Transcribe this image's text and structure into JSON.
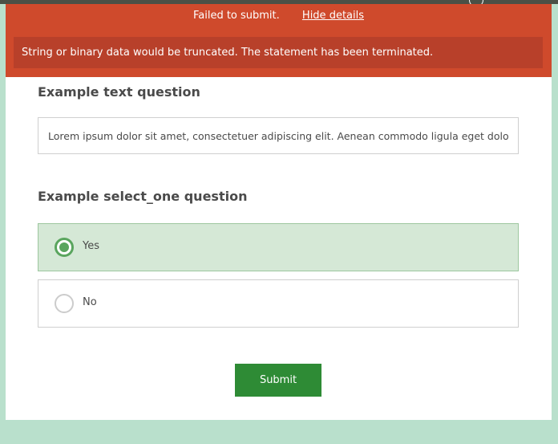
{
  "error_banner": {
    "summary": "Failed to submit.",
    "toggle_link": "Hide details",
    "details": "String or binary data would be truncated. The statement has been terminated."
  },
  "questions": {
    "text_question": {
      "label": "Example text question",
      "value": "Lorem ipsum dolor sit amet, consectetuer adipiscing elit. Aenean commodo ligula eget dolor."
    },
    "select_one_question": {
      "label": "Example select_one question",
      "options": [
        {
          "label": "Yes",
          "selected": true
        },
        {
          "label": "No",
          "selected": false
        }
      ]
    }
  },
  "submit_label": "Submit",
  "colors": {
    "page_background": "#b9e0cc",
    "error_banner": "#cf4a2c",
    "error_details": "#b8402a",
    "selected_option": "#d5e8d6",
    "radio_accent": "#5aa55e",
    "submit_button": "#2e8b35"
  },
  "icons": {
    "top_right": "globe-icon"
  }
}
